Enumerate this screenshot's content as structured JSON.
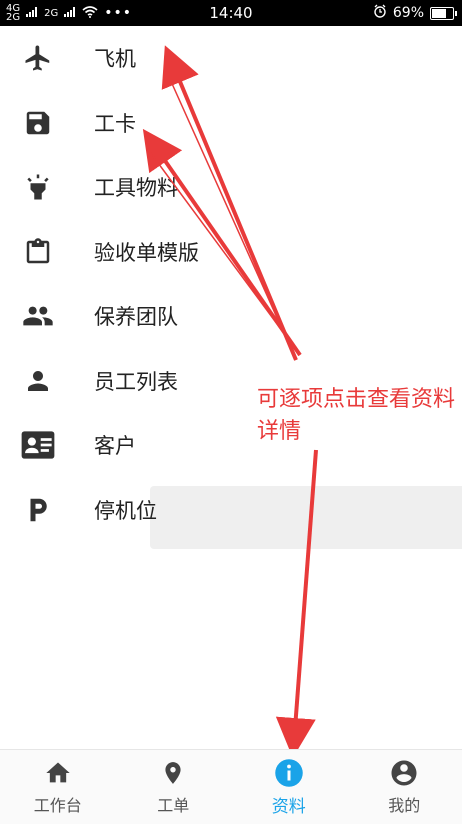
{
  "status_bar": {
    "network_left": "4G",
    "network_left_sub": "2G",
    "network_right": "2G",
    "time": "14:40",
    "battery": "69%",
    "battery_level": 0.69
  },
  "menu": {
    "items": [
      {
        "label": "飞机",
        "icon": "airplane-icon"
      },
      {
        "label": "工卡",
        "icon": "save-card-icon"
      },
      {
        "label": "工具物料",
        "icon": "flashlight-icon"
      },
      {
        "label": "验收单模版",
        "icon": "clipboard-icon"
      },
      {
        "label": "保养团队",
        "icon": "team-icon"
      },
      {
        "label": "员工列表",
        "icon": "person-icon"
      },
      {
        "label": "客户",
        "icon": "contact-card-icon"
      },
      {
        "label": "停机位",
        "icon": "parking-icon"
      }
    ]
  },
  "annotation": {
    "text": "可逐项点击查看资料详情",
    "color": "#e83a3a"
  },
  "tabbar": {
    "tabs": [
      {
        "label": "工作台",
        "icon": "home-icon"
      },
      {
        "label": "工单",
        "icon": "location-pin-icon"
      },
      {
        "label": "资料",
        "icon": "info-icon",
        "active": true
      },
      {
        "label": "我的",
        "icon": "account-icon"
      }
    ],
    "active_color": "#1aa3e8"
  }
}
